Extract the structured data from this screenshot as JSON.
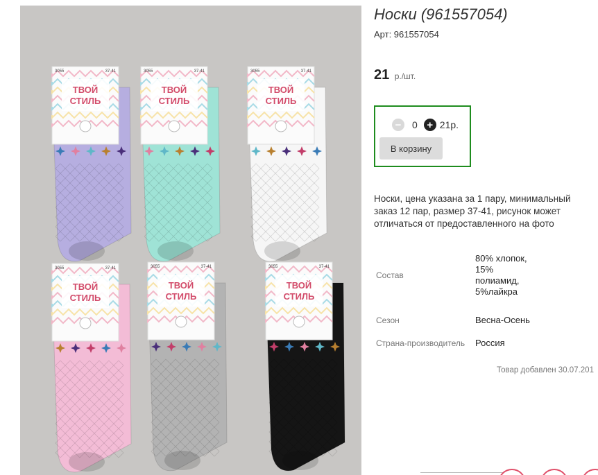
{
  "product": {
    "title": "Носки (961557054)",
    "article": "Арт: 961557054",
    "price_value": "21",
    "price_unit": "р./шт.",
    "description": "Носки, цена указана за 1 пару, минимальный заказ 12 пар, размер 37-41, рисунок может отличаться от предоставленного на фото",
    "added_text": "Товар добавлен 30.07.201"
  },
  "order": {
    "minus": "−",
    "quantity": "0",
    "plus": "+",
    "sum": "21р.",
    "cart_button": "В корзину"
  },
  "specs": [
    {
      "label": "Состав",
      "value": "80% хлопок, 15% полиамид, 5%лайкра"
    },
    {
      "label": "Сезон",
      "value": "Весна-Осень"
    },
    {
      "label": "Страна-производитель",
      "value": "Россия"
    }
  ],
  "photo_labels": {
    "brand_line1": "ТВОЙ",
    "brand_line2": "СТИЛЬ",
    "model": "3055",
    "size": "37-41"
  },
  "colors": {
    "order_border": "#1e8c1e",
    "sock_colors": [
      "#b6aee0",
      "#9fe3d6",
      "#f6f6f6",
      "#f3bcd6",
      "#b3b3b3",
      "#151515"
    ]
  }
}
